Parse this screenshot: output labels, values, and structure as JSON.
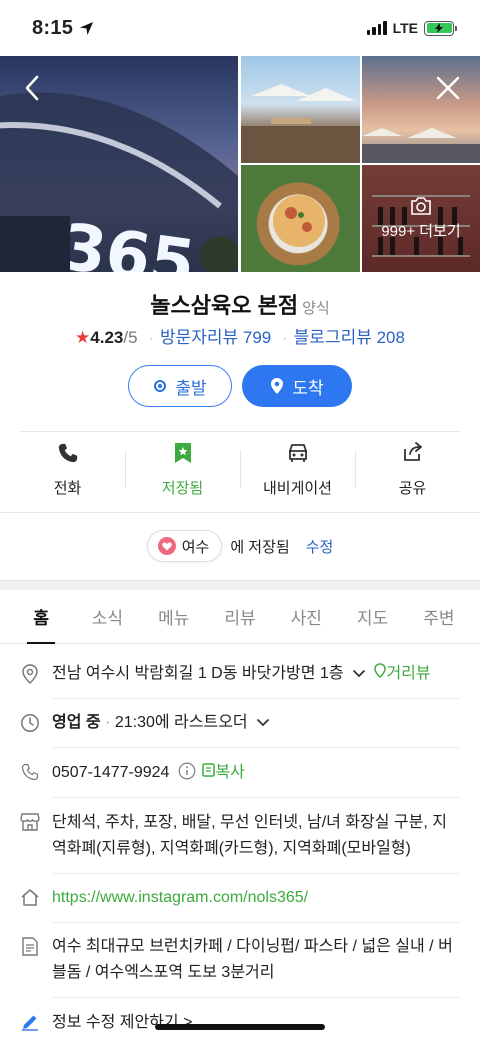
{
  "status_bar": {
    "time": "8:15",
    "network": "LTE"
  },
  "gallery": {
    "more_label": "999+ 더보기"
  },
  "place": {
    "name": "놀스삼육오 본점",
    "category": "양식",
    "rating": "4.23",
    "rating_max": "/5",
    "visitor_reviews": "방문자리뷰 799",
    "blog_reviews": "블로그리뷰 208"
  },
  "route": {
    "start_label": "출발",
    "arrive_label": "도착"
  },
  "actions": [
    {
      "label": "전화"
    },
    {
      "label": "저장됨"
    },
    {
      "label": "내비게이션"
    },
    {
      "label": "공유"
    }
  ],
  "saved": {
    "folder": "여수",
    "saved_text": "에 저장됨",
    "edit_label": "수정"
  },
  "tabs": [
    {
      "label": "홈"
    },
    {
      "label": "소식"
    },
    {
      "label": "메뉴"
    },
    {
      "label": "리뷰"
    },
    {
      "label": "사진"
    },
    {
      "label": "지도"
    },
    {
      "label": "주변"
    }
  ],
  "info": {
    "address": "전남 여수시 박람회길 1 D동 바닷가방면 1층",
    "distance_view": "거리뷰",
    "open_status": "영업 중",
    "last_order": "21:30에 라스트오더",
    "phone": "0507-1477-9924",
    "copy_label": "복사",
    "amenities": "단체석, 주차, 포장, 배달, 무선 인터넷, 남/녀 화장실 구분, 지역화폐(지류형), 지역화폐(카드형), 지역화폐(모바일형)",
    "website": "https://www.instagram.com/nols365/",
    "description": "여수 최대규모 브런치카페 / 다이닝펍/ 파스타 / 넓은 실내 / 버블돔 / 여수엑스포역 도보 3분거리",
    "suggest_edit": "정보 수정 제안하기 >"
  },
  "colors": {
    "accent_blue": "#2d78f0",
    "saved_green": "#3daa3d",
    "star_red": "#e8413c"
  }
}
